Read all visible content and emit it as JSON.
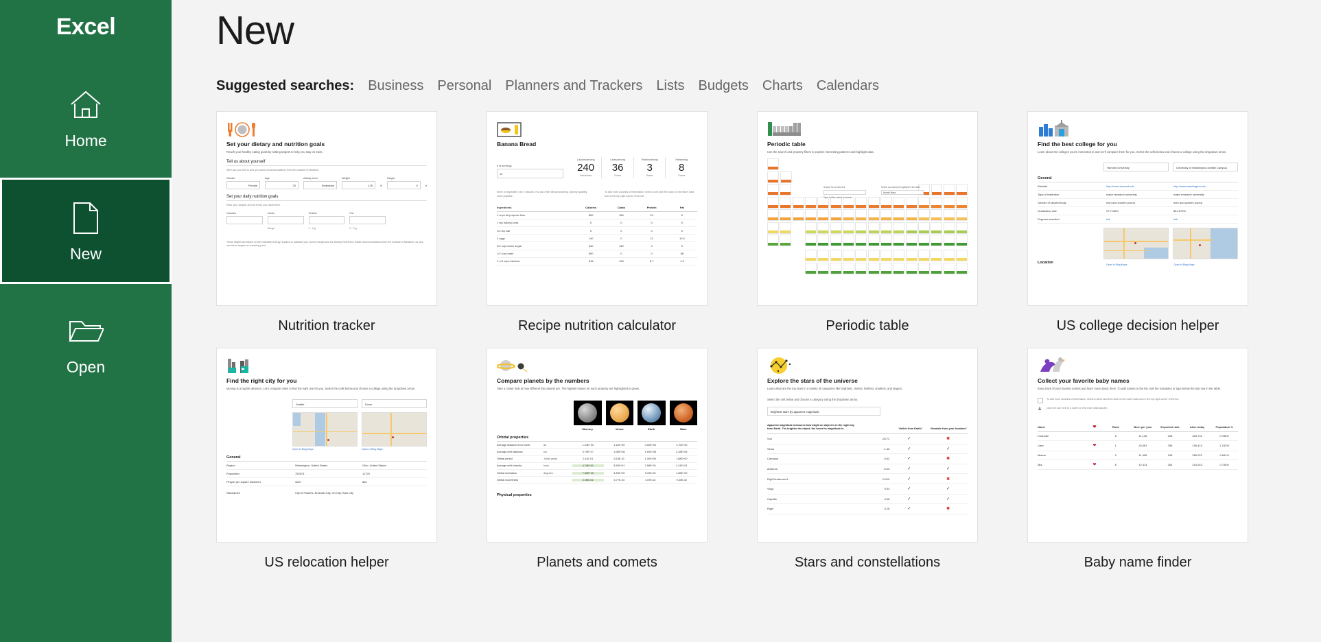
{
  "sidebar": {
    "brand": "Excel",
    "items": [
      {
        "label": "Home",
        "icon": "home-icon",
        "selected": false
      },
      {
        "label": "New",
        "icon": "new-document-icon",
        "selected": true
      },
      {
        "label": "Open",
        "icon": "folder-open-icon",
        "selected": false
      }
    ]
  },
  "header": {
    "title": "New",
    "suggested_label": "Suggested searches:",
    "suggested": [
      "Business",
      "Personal",
      "Planners and Trackers",
      "Lists",
      "Budgets",
      "Charts",
      "Calendars"
    ]
  },
  "colors": {
    "brand_green": "#217346",
    "selected_green": "#0e5130",
    "page_background": "#f3f3f3",
    "card_background": "#ffffff",
    "link_blue": "#2a6fc9",
    "accent_orange": "#ed7d31",
    "accent_green": "#4c9a2a",
    "heart_red": "#c0182b"
  },
  "templates": [
    {
      "label": "Nutrition tracker",
      "icon": "plate-cutlery-icon",
      "heading": "Set your dietary and nutrition goals",
      "subheading": "Reach your healthy eating goals by setting targets to help you stay on track.",
      "section1": "Tell us about yourself",
      "note1": "We'll use your info to give you some recommendations from the Institute of Medicine.",
      "fields1": [
        {
          "label": "Gender",
          "value": "Female",
          "unit": ""
        },
        {
          "label": "Age",
          "value": "25",
          "unit": ""
        },
        {
          "label": "Activity level",
          "value": "Sedentary",
          "unit": ""
        },
        {
          "label": "Weight",
          "value": "125",
          "unit": "lb"
        },
        {
          "label": "Height",
          "value": "5",
          "unit": "ft"
        }
      ],
      "section2": "Set your daily nutrition goals",
      "note2": "Enter your targets, and we'll help you reach them.",
      "fields2": [
        {
          "label": "Calories",
          "value": "",
          "hint": ""
        },
        {
          "label": "Carbs",
          "value": "",
          "hint": "Range"
        },
        {
          "label": "Protein",
          "value": "",
          "hint": "0 - 0 g"
        },
        {
          "label": "Fat",
          "value": "",
          "hint": "0 - 0 g"
        }
      ],
      "footnote": "These targets are based on the estimated energy required to maintain your current weight and the Dietary Reference Intake recommendations from the Institute of Medicine, so only use these targets as a starting point."
    },
    {
      "label": "Recipe nutrition calculator",
      "icon": "recipe-card-icon",
      "heading": "Banana Bread",
      "servings_label": "# of servings",
      "servings_value": "12",
      "stats": [
        {
          "label": "Calories/serving",
          "value": "240",
          "unit": "Kilocalories"
        },
        {
          "label": "Carbs/serving",
          "value": "36",
          "unit": "Grams"
        },
        {
          "label": "Protein/serving",
          "value": "3",
          "unit": "Grams"
        },
        {
          "label": "Fat/serving",
          "value": "8",
          "unit": "Grams"
        }
      ],
      "note_left": "Enter an ingredient, like 2 biscuits. You can enter almost anything. Specify quantity when possible.",
      "note_right": "To add more columns of information, select a cell and then click on the Insert Data icon in the top right corner of the list.",
      "columns": [
        "Ingredients",
        "Calories",
        "Carbs",
        "Protein",
        "Fat"
      ],
      "rows": [
        [
          "2 cups all-purpose flour",
          "800",
          "184",
          "24",
          "0"
        ],
        [
          "1 tsp baking soda",
          "0",
          "0",
          "0",
          "0"
        ],
        [
          "1/4 tsp salt",
          "0",
          "0",
          "0",
          "0"
        ],
        [
          "2 eggs",
          "140",
          "0",
          "12",
          "10.0"
        ],
        [
          "3/4 cup brown sugar",
          "540",
          "140",
          "0",
          "0"
        ],
        [
          "1/2 cup butter",
          "800",
          "0",
          "0",
          "88"
        ],
        [
          "2 1/3 cups banana",
          "516",
          "130",
          "6.7",
          "1.9"
        ]
      ]
    },
    {
      "label": "Periodic table",
      "icon": "periodic-chart-icon",
      "heading": "Periodic table",
      "subheading": "Use the search and property filters to explore interesting patterns and highlight data.",
      "search_label": "Search for an element",
      "search_placeholder": "Type to filter, select to search",
      "filter_label": "Select a property to highlight in the table",
      "filter_value": "Atomic Mass"
    },
    {
      "label": "US college decision helper",
      "icon": "campus-buildings-icon",
      "heading": "Find the best college for you",
      "subheading": "Learn about the colleges you're interested in and we'll compare them for you. Select the cells below and choose a college using the dropdown arrow.",
      "col1": "Harvard University",
      "col2": "University of Washington-Seattle Campus",
      "section": "General",
      "rows": [
        {
          "label": "Website",
          "v1": "http://www.harvard.edu",
          "v2": "http://www.washington.edu",
          "link": true
        },
        {
          "label": "Type of institution",
          "v1": "major research university",
          "v2": "major research university",
          "link": false
        },
        {
          "label": "Gender of student body",
          "v1": "men and women (coed)",
          "v2": "men and women (coed)",
          "link": false
        },
        {
          "label": "Graduation rate",
          "v1": "97.7136%",
          "v2": "86.1579%",
          "link": false
        },
        {
          "label": "Degrees awarded",
          "v1": "link",
          "v2": "link",
          "link": true
        }
      ],
      "location_label": "Location",
      "maplink": "Open in Bing Maps"
    },
    {
      "label": "US relocation helper",
      "icon": "city-skyline-icon",
      "heading": "Find the right city for you",
      "subheading": "Moving is a big life decision. Let's compare cities to find the right one for you. Select the cells below and choose a college using the dropdown arrow.",
      "col1": "Seattle",
      "col2": "Dover",
      "maplink": "Open in Bing Maps",
      "section": "General",
      "rows": [
        {
          "label": "Region",
          "v1": "Washington, United States",
          "v2": "Ohio, United States"
        },
        {
          "label": "Population",
          "v1": "752675",
          "v2": "11720"
        },
        {
          "label": "People per square kilometer",
          "v1": "3267",
          "v2": "864"
        },
        {
          "label": "Nicknames",
          "v1": "City of Flowers, Emerald City, Jet City, Rain City",
          "v2": ""
        }
      ]
    },
    {
      "label": "Planets and comets",
      "icon": "saturn-icon",
      "heading": "Compare planets by the numbers",
      "subheading": "Take a closer look at how different the planets are. The highest values for each property are highlighted in green.",
      "planets": [
        "Mercury",
        "Venus",
        "Earth",
        "Mars"
      ],
      "section1": "Orbital properties",
      "section2": "Physical properties",
      "rows": [
        {
          "label": "Average distance from Earth",
          "unit": "au",
          "values": [
            "1.24E+00",
            "1.14E+00",
            "0.00E+00",
            "1.70E+00"
          ],
          "hi": -1
        },
        {
          "label": "Average orbit distance",
          "unit": "km",
          "values": [
            "5.79E+07",
            "1.08E+08",
            "1.50E+08",
            "2.28E+08"
          ],
          "hi": -1
        },
        {
          "label": "Orbital period",
          "unit": "Julian years",
          "values": [
            "2.41E-01",
            "6.15E-01",
            "1.00E+00",
            "1.88E+00"
          ],
          "hi": -1
        },
        {
          "label": "Average orbit velocity",
          "unit": "km/s",
          "values": [
            "4.74E+01",
            "3.50E+01",
            "2.98E+01",
            "2.41E+01"
          ],
          "hi": 0
        },
        {
          "label": "Orbital inclination",
          "unit": "degrees",
          "values": [
            "7.00E+00",
            "3.39E+00",
            "5.00E-05",
            "1.85E+00"
          ],
          "hi": 0
        },
        {
          "label": "Orbital eccentricity",
          "unit": "",
          "values": [
            "2.06E-01",
            "6.77E-03",
            "1.67E-02",
            "9.34E-02"
          ],
          "hi": 0
        }
      ]
    },
    {
      "label": "Stars and constellations",
      "icon": "constellation-icon",
      "heading": "Explore the stars of the universe",
      "subheading": "Learn what are the top stars in a variety of categories like brightest, closest, farthest, smallest, and largest.",
      "prompt": "Select the cell below and choose a category using the dropdown arrow.",
      "selected_category": "Brightest stars by apparent magnitude",
      "col_desc": "Apparent magnitude measures how bright an object is in the night sky from Earth. The brighter the object, the lower its magnitude is.",
      "col_visible": "Visible from Earth?",
      "col_viewable": "Viewable from your location?",
      "rows": [
        {
          "name": "Sun",
          "mag": "-26.72",
          "visible": true,
          "viewable": false
        },
        {
          "name": "Sirius",
          "mag": "-1.46",
          "visible": true,
          "viewable": true
        },
        {
          "name": "Canopus",
          "mag": "-0.62",
          "visible": true,
          "viewable": false
        },
        {
          "name": "Arcturus",
          "mag": "-0.05",
          "visible": true,
          "viewable": true
        },
        {
          "name": "Rigil Kentaurus A",
          "mag": "-0.010",
          "visible": true,
          "viewable": false
        },
        {
          "name": "Vega",
          "mag": "0.03",
          "visible": true,
          "viewable": true
        },
        {
          "name": "Capella",
          "mag": "0.08",
          "visible": true,
          "viewable": true
        },
        {
          "name": "Rigel",
          "mag": "0.18",
          "visible": true,
          "viewable": false
        }
      ]
    },
    {
      "label": "Baby name finder",
      "icon": "stork-baby-icon",
      "heading": "Collect your favorite baby names",
      "subheading": "Keep track of your favorite names and learn more about them. To add names to the list, edit the examples or type below the last row in the table.",
      "tip1": "To add more columns of information, select a name and then click on the Insert Data icon in the top right corner of the list.",
      "tip2": "Click the icon next to a name to view more data about it.",
      "columns": [
        "Name",
        "",
        "Rank",
        "Born per year",
        "Expected rank",
        "Alive today",
        "Population %"
      ],
      "rows": [
        {
          "name": "Charlotte",
          "fav": false,
          "rank": "8",
          "born": "11,138",
          "expected": "208",
          "alive": "253,731",
          "pop": "0.788%"
        },
        {
          "name": "Liam",
          "fav": true,
          "rank": "1",
          "born": "20,063",
          "expected": "298",
          "alive": "195,415",
          "pop": "1.152%"
        },
        {
          "name": "Mason",
          "fav": false,
          "rank": "9",
          "born": "11,408",
          "expected": "198",
          "alive": "265,222",
          "pop": "0.641%"
        },
        {
          "name": "Mia",
          "fav": true,
          "rank": "8",
          "born": "12,414",
          "expected": "264",
          "alive": "214,043",
          "pop": "0.746%"
        }
      ]
    }
  ]
}
